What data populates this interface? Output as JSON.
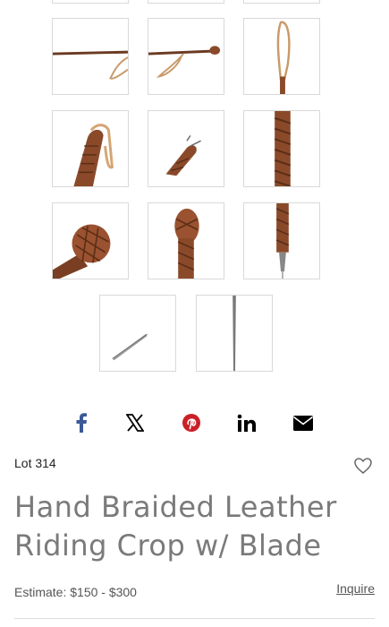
{
  "gallery": {
    "thumbnails": [
      "crop-shaft-with-loop",
      "crop-knob-end",
      "crop-upright-with-loop",
      "braided-loop-detail",
      "braided-tip-detail",
      "braided-shaft-closeup",
      "braided-knob-angled",
      "braided-knob-front",
      "braided-shaft-to-tip",
      "blade-diagonal",
      "blade-vertical"
    ]
  },
  "share": {
    "icons": [
      "facebook-icon",
      "x-icon",
      "pinterest-icon",
      "linkedin-icon",
      "email-icon"
    ],
    "colors": {
      "facebook": "#3b5998",
      "x": "#000000",
      "pinterest": "#cb2027",
      "linkedin": "#000000",
      "email": "#000000"
    }
  },
  "lot": {
    "label": "Lot 314"
  },
  "title": "Hand Braided Leather Riding Crop w/ Blade",
  "estimate": {
    "text": "Estimate: $150 - $300"
  },
  "inquire": {
    "label": "Inquire"
  },
  "colors": {
    "leather": "#8a4a2a",
    "title": "#7a7a7a",
    "border": "#d9d9d9"
  }
}
